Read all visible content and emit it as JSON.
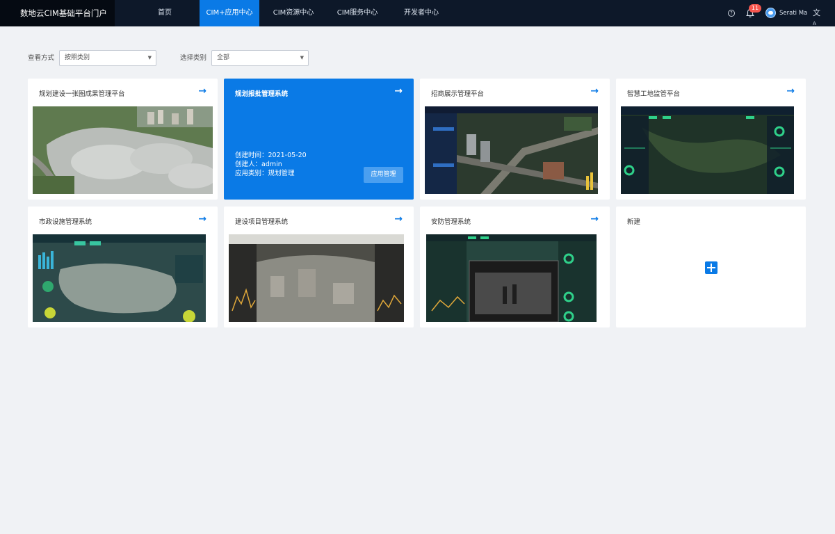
{
  "app": {
    "title": "数地云CIM基础平台门户"
  },
  "nav": {
    "items": [
      {
        "label": "首页"
      },
      {
        "label": "CIM+应用中心"
      },
      {
        "label": "CIM资源中心"
      },
      {
        "label": "CIM服务中心"
      },
      {
        "label": "开发者中心"
      }
    ],
    "active_index": 1
  },
  "header_right": {
    "help_icon": "question-circle-icon",
    "notification_icon": "bell-icon",
    "notification_count": "11",
    "user_name": "Serati Ma",
    "language_icon": "translate-icon"
  },
  "filters": {
    "view_mode_label": "查看方式",
    "view_mode_value": "按照类别",
    "category_label": "选择类别",
    "category_value": "全部"
  },
  "cards": [
    {
      "title": "规划建设一张图成果管理平台"
    },
    {
      "title": "规划报批管理系统",
      "created_time": "创建时间：2021-05-20",
      "creator": "创建人：admin",
      "app_category": "应用类别：规划管理",
      "manage_button": "应用管理"
    },
    {
      "title": "招商展示管理平台"
    },
    {
      "title": "智慧工地监管平台"
    },
    {
      "title": "市政设施管理系统"
    },
    {
      "title": "建设项目管理系统"
    },
    {
      "title": "安防管理系统"
    },
    {
      "title": "新建"
    }
  ],
  "colors": {
    "accent": "#0a7ae6",
    "nav_bg": "#0d1829",
    "page_bg": "#f0f2f5",
    "badge": "#f5564f"
  }
}
